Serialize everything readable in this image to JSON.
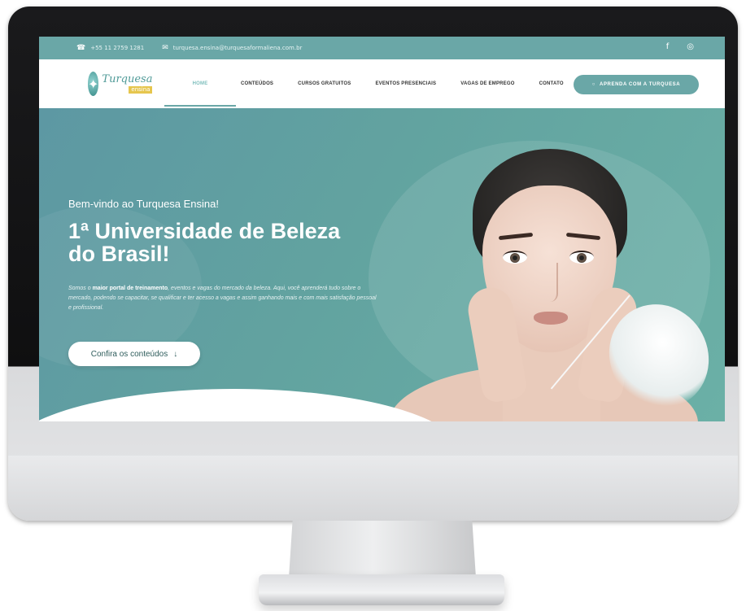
{
  "topbar": {
    "phone": "+55 11 2759 1281",
    "email": "turquesa.ensina@turquesaformaliena.com.br",
    "social": [
      "f",
      "◎"
    ]
  },
  "nav": {
    "logo_text": "Turquesa",
    "logo_sub": "ensina",
    "items": [
      "HOME",
      "CONTEÚDOS",
      "CURSOS GRATUITOS",
      "EVENTOS PRESENCIAIS",
      "VAGAS DE EMPREGO",
      "CONTATO"
    ],
    "active": "HOME",
    "cta": "APRENDA COM A TURQUESA"
  },
  "hero": {
    "welcome": "Bem-vindo ao Turquesa Ensina!",
    "headline": "1ª Universidade de Beleza do Brasil!",
    "para_intro": "Somos o ",
    "para_bold": "maior portal de treinamento",
    "para_rest": ", eventos e vagas do mercado da beleza. Aqui, você aprenderá tudo sobre o mercado, podendo se capacitar, se qualificar e ter acesso a vagas e assim ganhando mais e com mais satisfação pessoal e profissional.",
    "button": "Confira os conteúdos",
    "button_icon": "↓"
  },
  "colors": {
    "accent": "#6aa7a7",
    "hero_bg": "#62a3a0"
  }
}
